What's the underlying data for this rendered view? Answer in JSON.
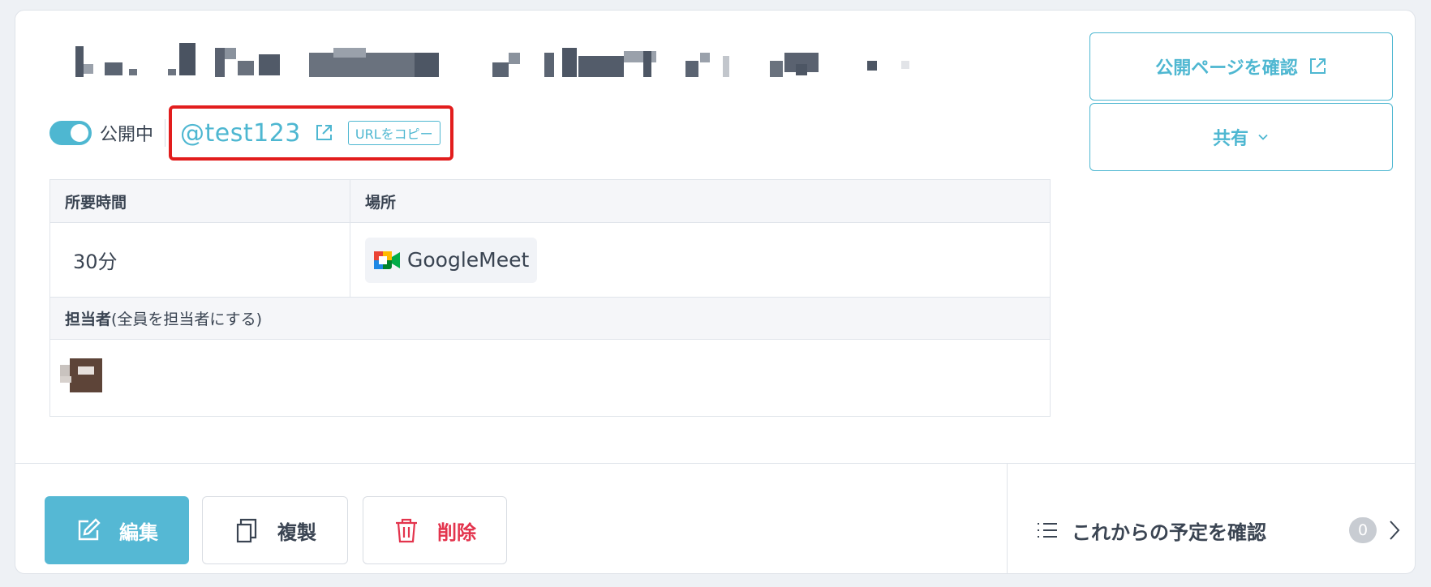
{
  "event": {
    "status_label": "公開中",
    "handle": "@test123",
    "copy_url_label": "URLをコピー"
  },
  "info_table": {
    "duration_header": "所要時間",
    "location_header": "場所",
    "duration_value": "30分",
    "location_value": "GoogleMeet",
    "assignee_header": "担当者",
    "assignee_sub": "(全員を担当者にする)"
  },
  "actions": {
    "view_public_page": "公開ページを確認",
    "share": "共有"
  },
  "footer": {
    "edit": "編集",
    "duplicate": "複製",
    "delete": "削除",
    "upcoming": "これからの予定を確認",
    "upcoming_count": "0"
  },
  "colors": {
    "accent": "#4eb7d1",
    "danger": "#e3344d",
    "highlight_border": "#e21d1d"
  },
  "icons": [
    "external-link-icon",
    "chevron-down-icon",
    "edit-icon",
    "copy-icon",
    "trash-icon",
    "list-icon",
    "chevron-right-icon",
    "google-meet-icon"
  ]
}
